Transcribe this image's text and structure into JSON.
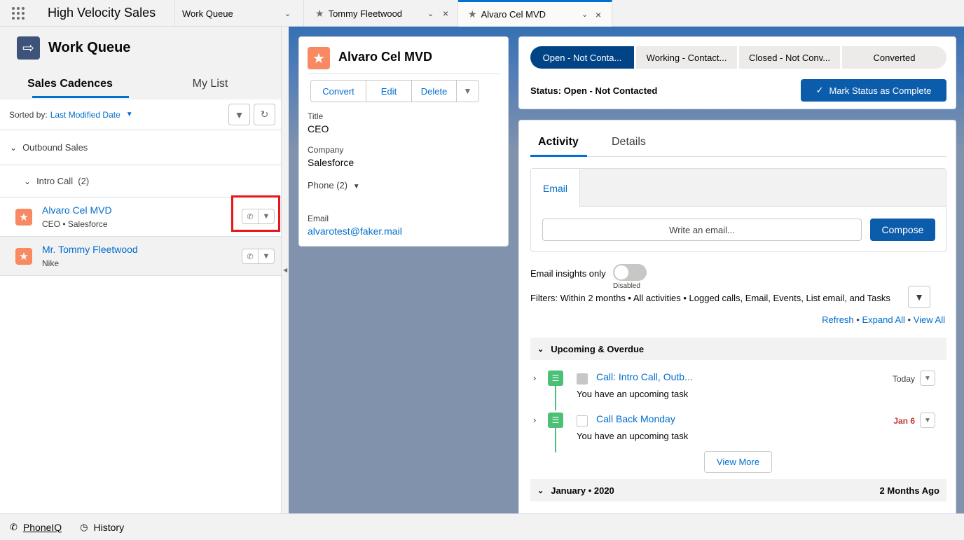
{
  "header": {
    "app_name": "High Velocity Sales",
    "tabs": [
      {
        "label": "Work Queue"
      },
      {
        "label": "Tommy Fleetwood"
      },
      {
        "label": "Alvaro Cel MVD"
      }
    ]
  },
  "left_panel": {
    "title": "Work Queue",
    "subtabs": [
      "Sales Cadences",
      "My List"
    ],
    "sorted_by_label": "Sorted by:",
    "sorted_by_value": "Last Modified Date",
    "group": "Outbound Sales",
    "subgroup": "Intro Call  (2)",
    "leads": [
      {
        "name": "Alvaro Cel MVD",
        "subtitle": "CEO • Salesforce"
      },
      {
        "name": "Mr. Tommy Fleetwood",
        "subtitle": "Nike"
      }
    ]
  },
  "record": {
    "name": "Alvaro Cel MVD",
    "actions": [
      "Convert",
      "Edit",
      "Delete"
    ],
    "fields": {
      "title_label": "Title",
      "title_value": "CEO",
      "company_label": "Company",
      "company_value": "Salesforce",
      "phone_label": "Phone (2)",
      "email_label": "Email",
      "email_value": "alvarotest@faker.mail"
    }
  },
  "path": {
    "steps": [
      "Open - Not Conta...",
      "Working - Contact...",
      "Closed - Not Conv...",
      "Converted"
    ],
    "status_text": "Status: Open - Not Contacted",
    "mark_complete_label": "Mark Status as Complete"
  },
  "activity": {
    "tabs": [
      "Activity",
      "Details"
    ],
    "composer_tab": "Email",
    "write_placeholder": "Write an email...",
    "compose_label": "Compose",
    "insights_label": "Email insights only",
    "toggle_state": "Disabled",
    "filters_text": "Filters: Within 2 months • All activities • Logged calls, Email, Events, List email, and Tasks",
    "links": [
      "Refresh",
      "Expand All",
      "View All"
    ],
    "upcoming_header": "Upcoming & Overdue",
    "tasks": [
      {
        "name": "Call: Intro Call, Outb...",
        "subtitle": "You have an upcoming task",
        "date": "Today"
      },
      {
        "name": "Call Back Monday",
        "subtitle": "You have an upcoming task",
        "date": "Jan 6"
      }
    ],
    "view_more_label": "View More",
    "month_header": "January • 2020",
    "month_right": "2 Months Ago"
  },
  "bottom_bar": {
    "items": [
      "PhoneIQ",
      "History"
    ]
  },
  "colors": {
    "brand_blue": "#0b5cab",
    "link_blue": "#006dcc",
    "path_current": "#014486",
    "lead_icon": "#f88962",
    "task_icon": "#4bc076",
    "highlight_red": "#e8151a"
  }
}
